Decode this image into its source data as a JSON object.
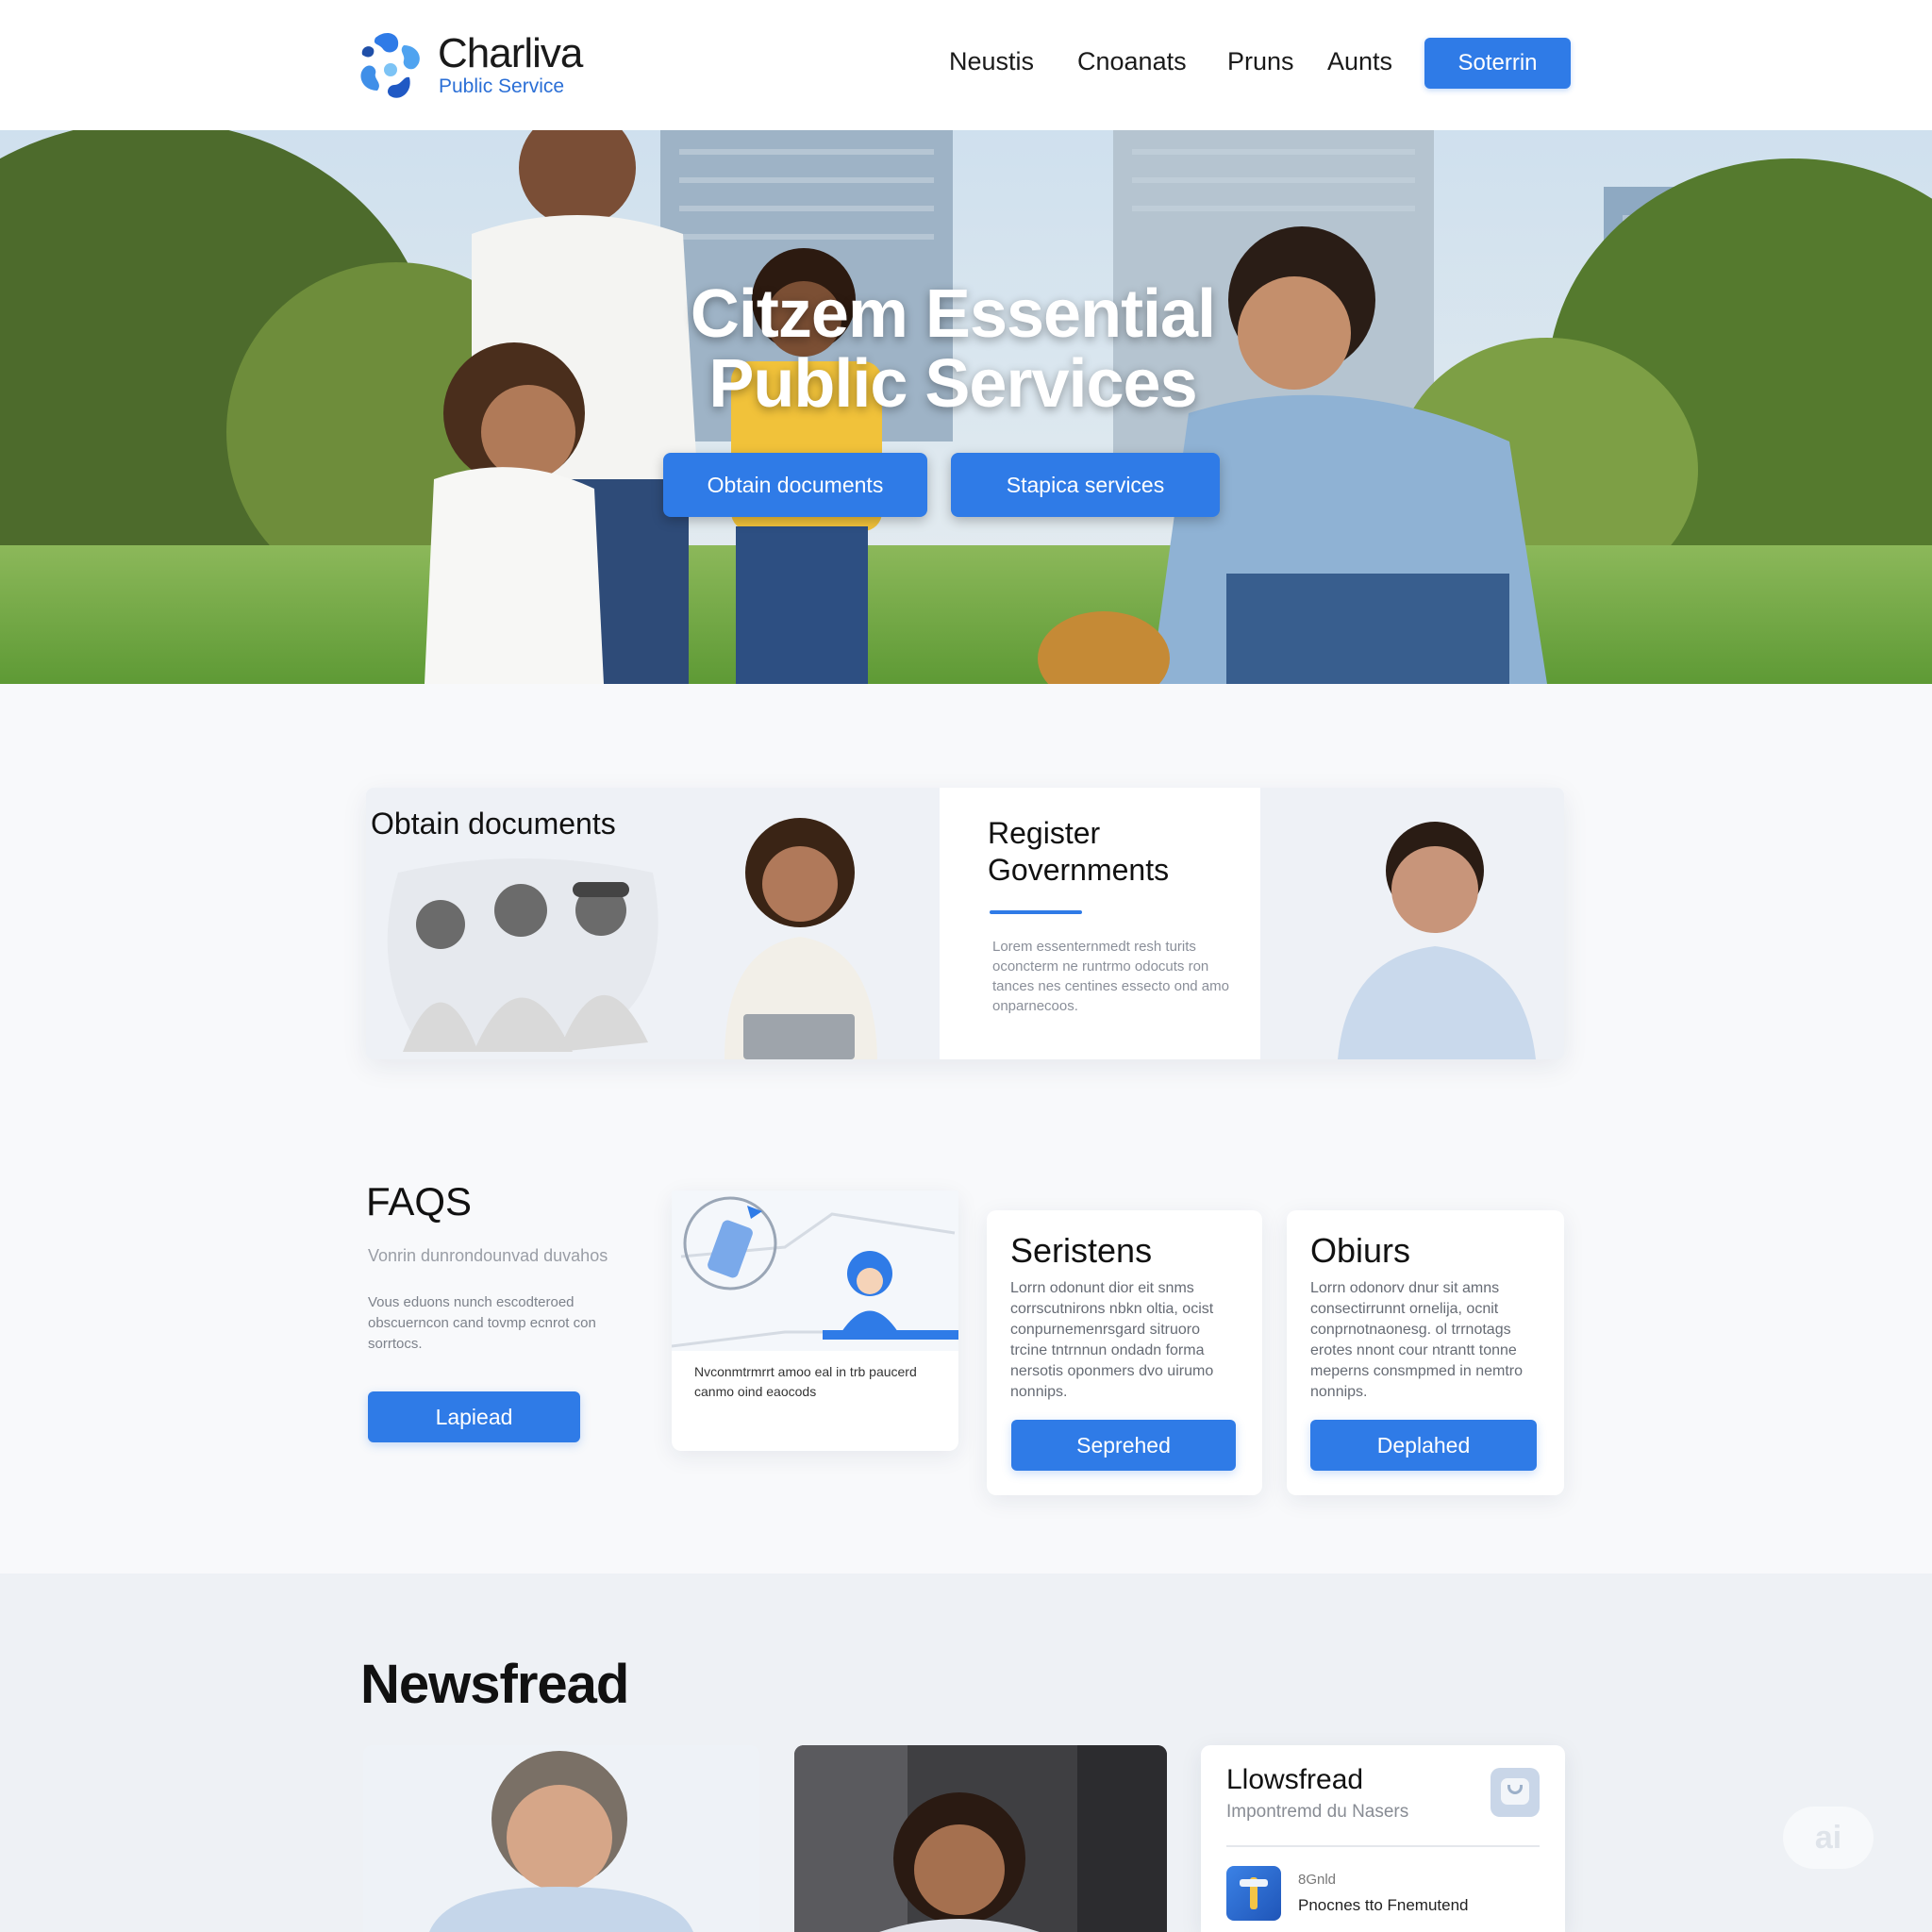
{
  "brand": {
    "name": "Charliva",
    "tagline": "Public Service",
    "colors": {
      "primary": "#2f7be7",
      "text": "#111111"
    }
  },
  "nav": {
    "links": [
      "Neustis",
      "Cnoanats",
      "Pruns",
      "Aunts"
    ],
    "cta": "Soterrin"
  },
  "hero": {
    "title_line1": "Citzem Essential",
    "title_line2": "Public Services",
    "buttons": [
      "Obtain documents",
      "Stapica services"
    ]
  },
  "features": {
    "obtain_title": "Obtain documents",
    "register_title_line1": "Register",
    "register_title_line2": "Governments",
    "register_text": [
      "Lorem essenternmedt resh turits",
      "oconcterm ne runtrmo odocuts ron",
      "tances nes centines essecto ond amo",
      "onparnecoos."
    ]
  },
  "faqs": {
    "title": "FAQS",
    "subtitle": "Vonrin dunrondounvad duvahos",
    "text": [
      "Vous eduons nunch escodteroed",
      "obscuerncon cand tovmp ecnrot con",
      "sorrtocs."
    ],
    "button": "Lapiead",
    "illustration_caption": [
      "Nvconmtrmrrt amoo eal in trb paucerd",
      "canmo oind eaocods"
    ]
  },
  "service_cards": [
    {
      "title": "Seristens",
      "text": [
        "Lorrn odonunt dior eit snms",
        "corrscutnirons nbkn oltia, ocist",
        "conpurnemenrsgard sitruoro",
        "trcine tntrnnun ondadn forma",
        "nersotis oponmers dvo uirumo",
        "nonnips."
      ],
      "button": "Seprehed"
    },
    {
      "title": "Obiurs",
      "text": [
        "Lorrn odonorv dnur sit amns",
        "consectirrunnt ornelija, ocnit",
        "conprnotnaonesg. ol trrnotags",
        "erotes nnont cour ntrantt tonne",
        "meperns consmpmed in nemtro",
        "nonnips."
      ],
      "button": "Deplahed"
    }
  ],
  "news": {
    "title": "Newsfread",
    "side": {
      "title": "Llowsfread",
      "subtitle": "Impontremd du Nasers",
      "date": "8Gnld",
      "item": "Pnocnes tto Fnemutend"
    }
  },
  "watermark": "ai"
}
